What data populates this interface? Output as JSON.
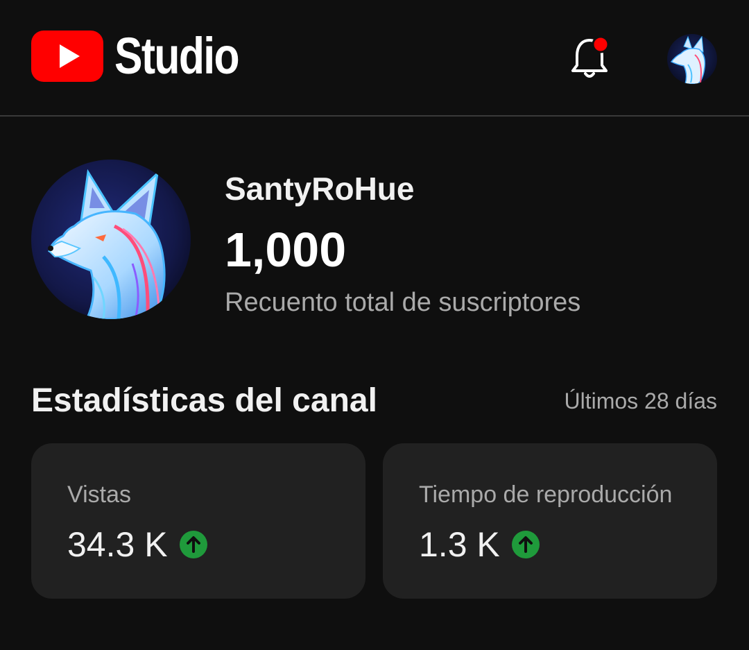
{
  "header": {
    "app_name": "Studio",
    "logo_icon": "youtube-play-icon",
    "notifications_icon": "bell-icon",
    "notification_dot_color": "#ff0000",
    "brand_color": "#ff0000"
  },
  "channel": {
    "name": "SantyRoHue",
    "subscriber_count": "1,000",
    "subscriber_label": "Recuento total de suscriptores",
    "avatar_icon": "fox-avatar"
  },
  "stats": {
    "title": "Estadísticas del canal",
    "period": "Últimos 28 días",
    "cards": [
      {
        "label": "Vistas",
        "value": "34.3 K",
        "trend_icon": "arrow-up-circle-icon",
        "trend_color": "#1f9a3b"
      },
      {
        "label": "Tiempo de reproducción",
        "value": "1.3 K",
        "trend_icon": "arrow-up-circle-icon",
        "trend_color": "#1f9a3b"
      }
    ]
  }
}
